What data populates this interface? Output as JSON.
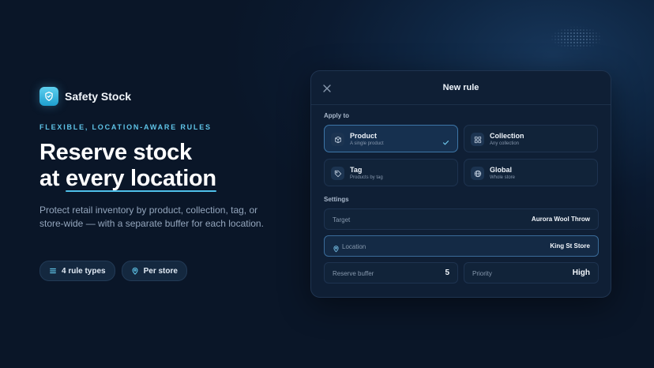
{
  "brand": {
    "name": "Safety Stock",
    "icon": "shield-check-icon",
    "accent": "#4fc0ea"
  },
  "hero": {
    "eyebrow": "FLEXIBLE, LOCATION-AWARE RULES",
    "headline_line1": "Reserve stock",
    "headline_prefix": "at ",
    "headline_highlight": "every location",
    "description": "Protect retail inventory by product, collection, tag, or store-wide — with a separate buffer for each location."
  },
  "pills": [
    {
      "label": "4 rule types",
      "icon": "list-icon"
    },
    {
      "label": "Per store",
      "icon": "location-pin-icon"
    }
  ],
  "modal": {
    "title": "New rule",
    "close_icon": "close-icon",
    "apply_to_label": "Apply to",
    "options": [
      {
        "title": "Product",
        "subtitle": "A single product",
        "icon": "box-icon",
        "selected": true
      },
      {
        "title": "Collection",
        "subtitle": "Any collection",
        "icon": "grid-icon",
        "selected": false
      },
      {
        "title": "Tag",
        "subtitle": "Products by tag",
        "icon": "tag-icon",
        "selected": false
      },
      {
        "title": "Global",
        "subtitle": "Whole store",
        "icon": "globe-icon",
        "selected": false
      }
    ],
    "settings_label": "Settings",
    "target": {
      "label": "Target",
      "value": "Aurora Wool Throw"
    },
    "location": {
      "label": "Location",
      "value": "King St Store"
    },
    "reserve_buffer": {
      "label": "Reserve buffer",
      "value": "5"
    },
    "priority": {
      "label": "Priority",
      "value": "High"
    }
  }
}
